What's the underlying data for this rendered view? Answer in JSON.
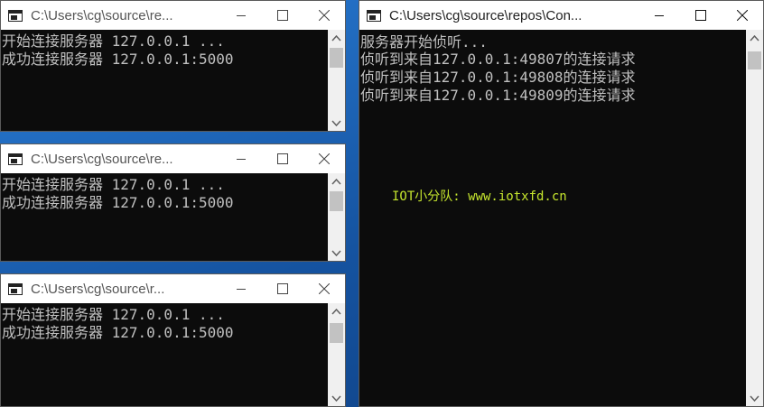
{
  "client_windows": [
    {
      "title": "C:\\Users\\cg\\source\\re...",
      "lines": [
        "开始连接服务器 127.0.0.1 ...",
        "成功连接服务器 127.0.0.1:5000"
      ]
    },
    {
      "title": "C:\\Users\\cg\\source\\re...",
      "lines": [
        "开始连接服务器 127.0.0.1 ...",
        "成功连接服务器 127.0.0.1:5000"
      ]
    },
    {
      "title": "C:\\Users\\cg\\source\\r...",
      "lines": [
        "开始连接服务器 127.0.0.1 ...",
        "成功连接服务器 127.0.0.1:5000"
      ]
    }
  ],
  "server_window": {
    "title": "C:\\Users\\cg\\source\\repos\\Con...",
    "lines": [
      "服务器开始侦听...",
      "侦听到来自127.0.0.1:49807的连接请求",
      "侦听到来自127.0.0.1:49808的连接请求",
      "侦听到来自127.0.0.1:49809的连接请求"
    ],
    "watermark": "IOT小分队: www.iotxfd.cn"
  },
  "icons": {
    "minimize": "minimize-icon",
    "maximize": "maximize-icon",
    "close": "close-icon",
    "app": "console-app-icon",
    "scroll_up": "chevron-up-icon",
    "scroll_down": "chevron-down-icon"
  },
  "colors": {
    "console_bg": "#0c0c0c",
    "console_text": "#c0c0c0",
    "watermark_text": "#c6e62e",
    "desktop_bg": "#1b5fa8"
  }
}
